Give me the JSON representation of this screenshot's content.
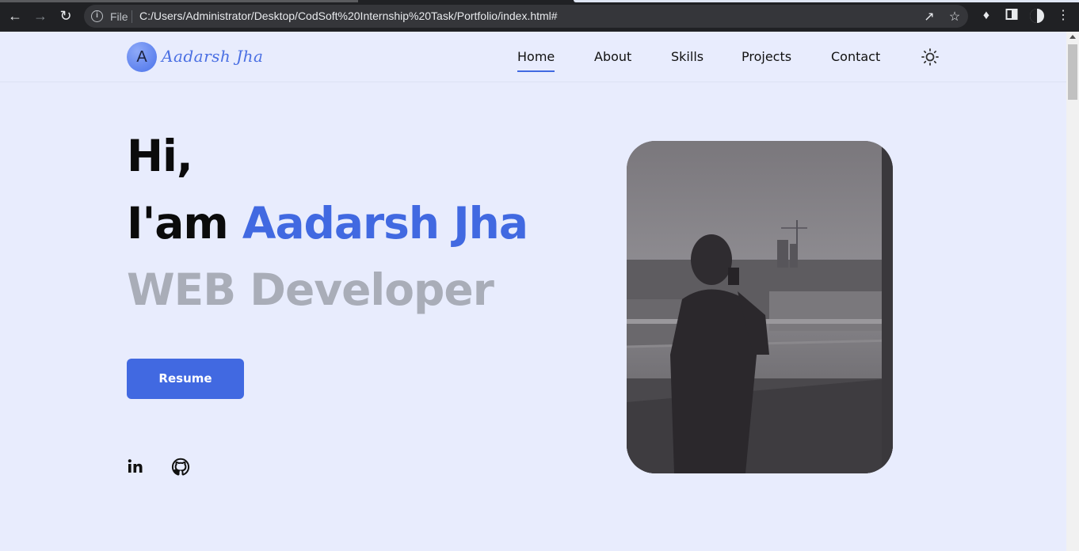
{
  "browser": {
    "file_label": "File",
    "url": "C:/Users/Administrator/Desktop/CodSoft%20Internship%20Task/Portfolio/index.html#"
  },
  "site": {
    "logo_initial": "A",
    "logo_name": "Aadarsh Jha"
  },
  "nav": {
    "items": [
      "Home",
      "About",
      "Skills",
      "Projects",
      "Contact"
    ],
    "active": "Home"
  },
  "hero": {
    "greeting": "Hi,",
    "intro_prefix": "I'am ",
    "name": "Aadarsh Jha",
    "role": "WEB Developer",
    "resume_label": "Resume"
  },
  "social": {
    "icons": [
      "linkedin-icon",
      "github-icon"
    ]
  },
  "colors": {
    "accent": "#4169e1",
    "background": "#e8ecfd",
    "muted": "#a9adb8"
  }
}
